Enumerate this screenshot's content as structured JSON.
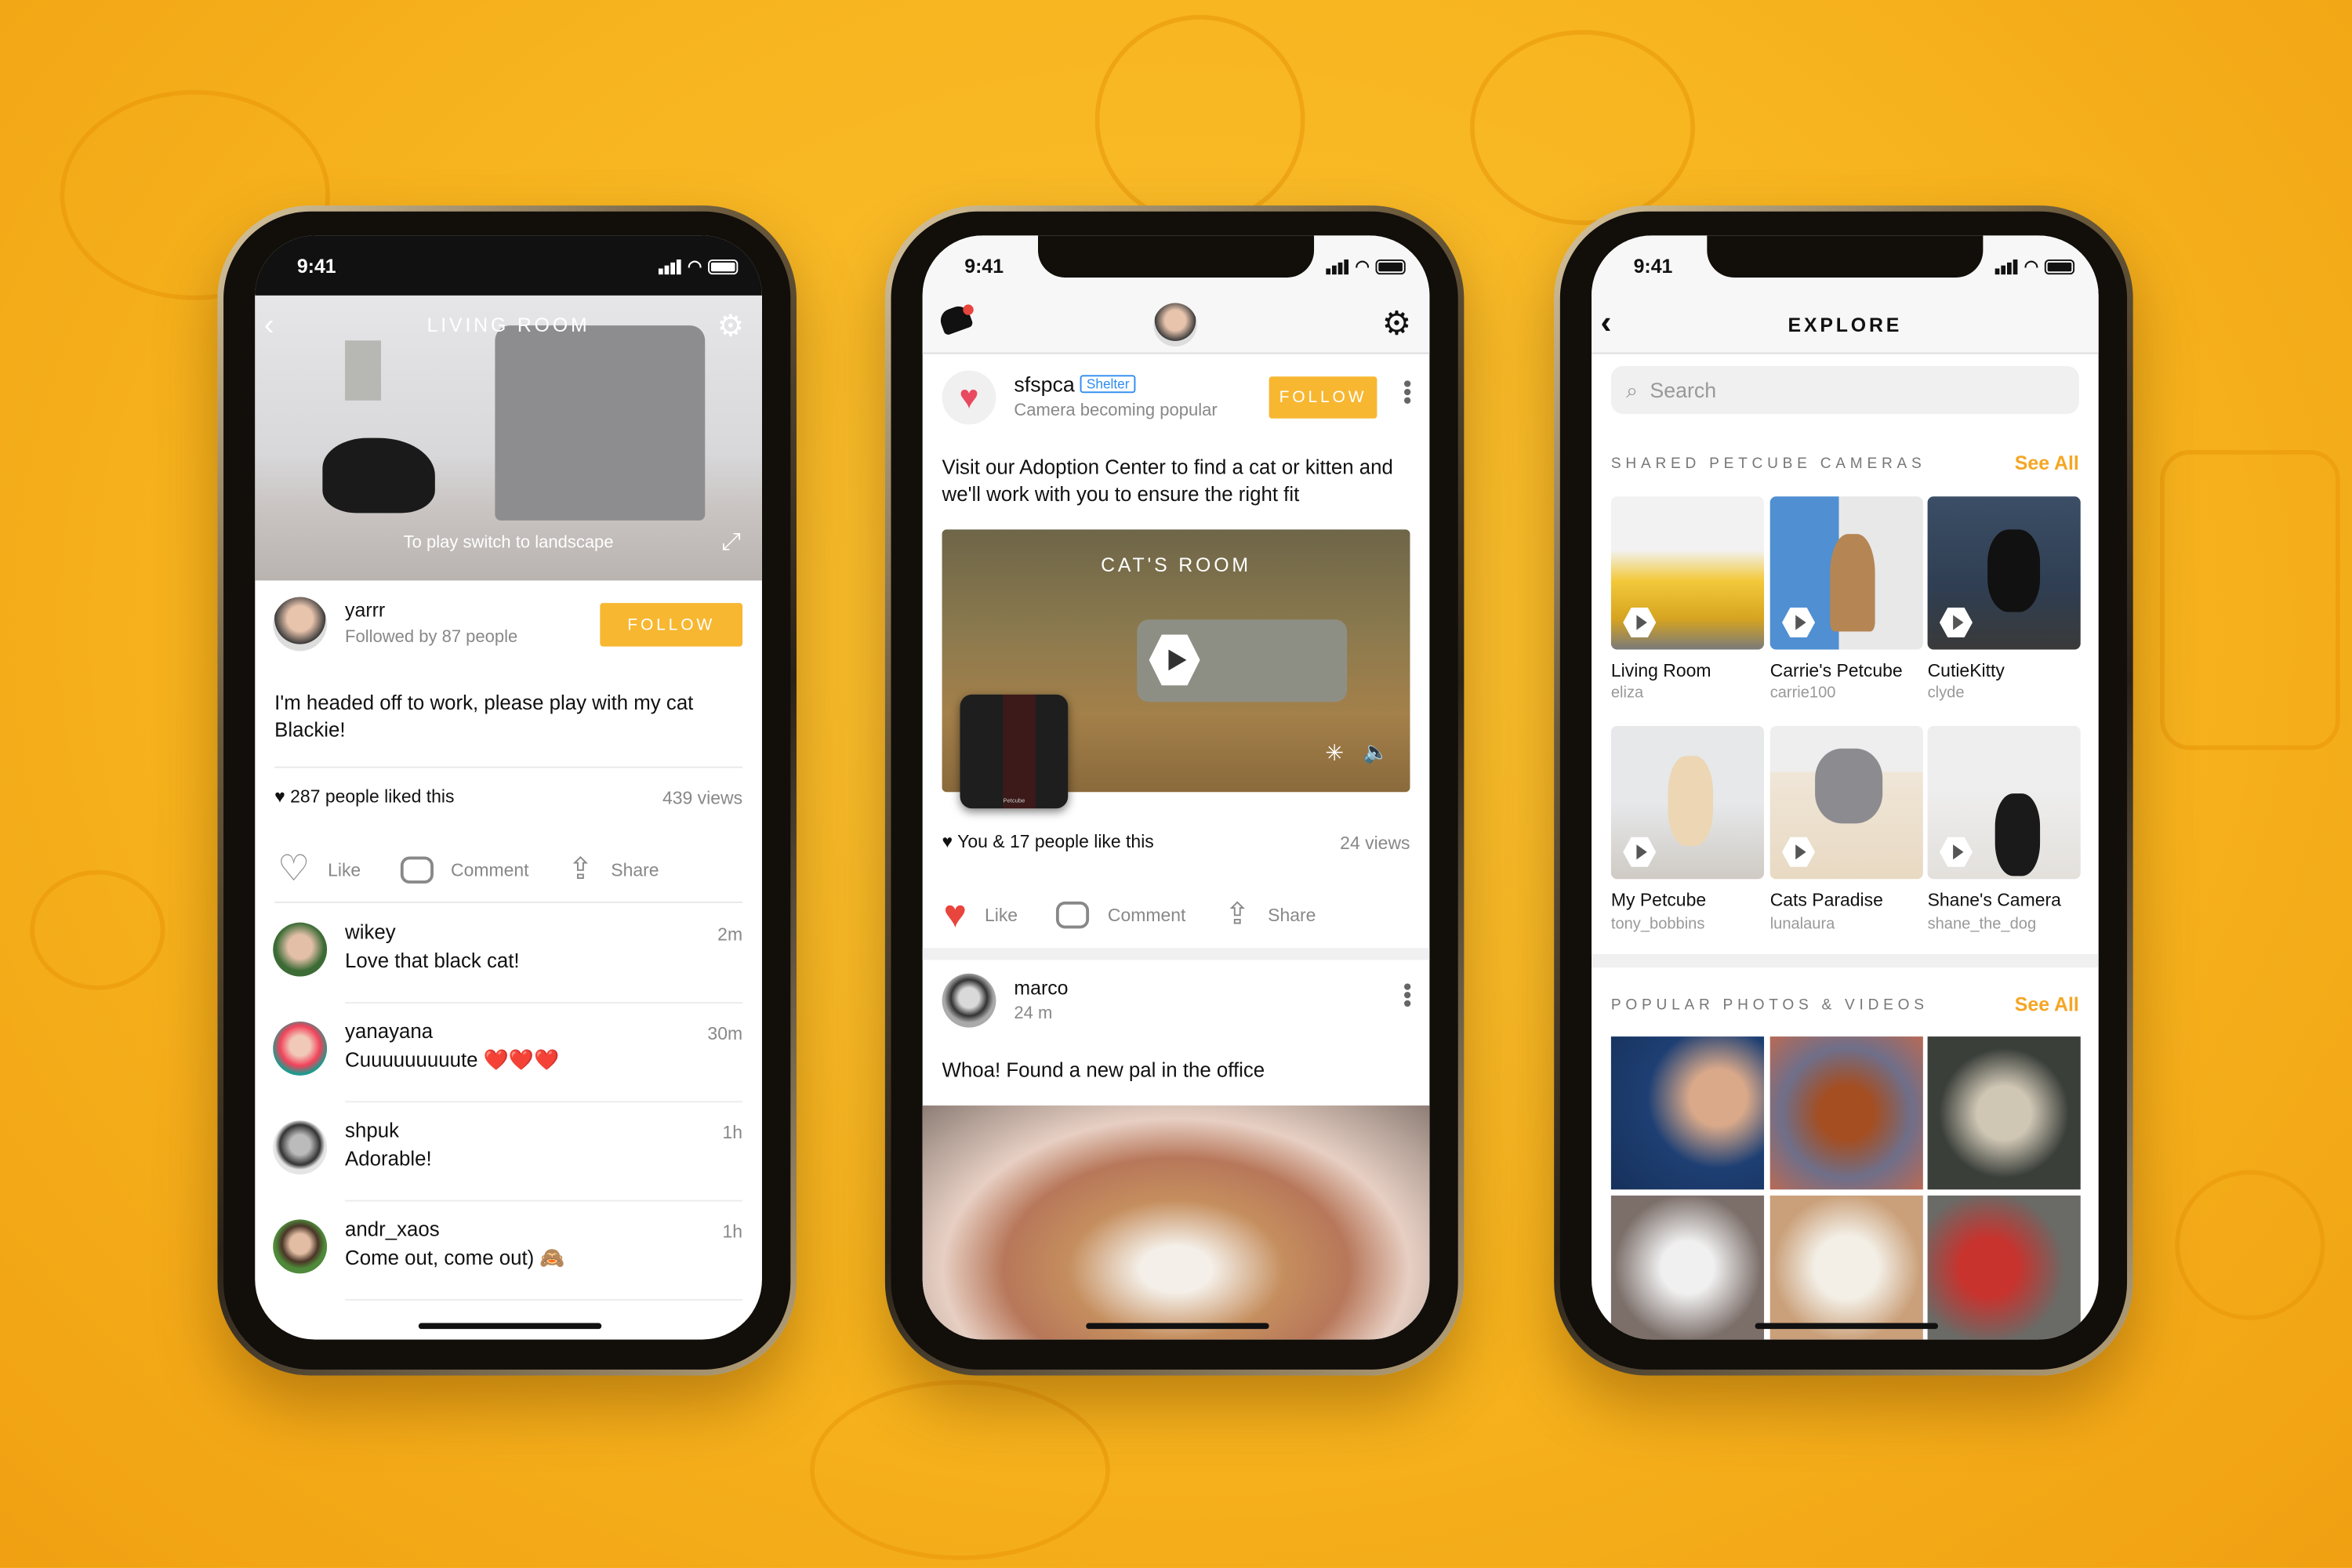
{
  "colors": {
    "accent": "#f7b731",
    "background": "#f6b21c",
    "like_red": "#e8453c",
    "shelter_blue": "#2d8cf0"
  },
  "phone1": {
    "status": {
      "time": "9:41"
    },
    "camera": {
      "title": "LIVING ROOM",
      "caption": "To play switch to landscape",
      "icons": [
        "back-icon",
        "gear-icon",
        "expand-icon"
      ]
    },
    "owner": {
      "name": "yarrr",
      "followed": "Followed by 87 people",
      "follow_label": "FOLLOW"
    },
    "post_text": "I'm headed off to work, please play with my cat Blackie!",
    "likes": "287 people liked this",
    "views": "439 views",
    "actions": {
      "like": "Like",
      "comment": "Comment",
      "share": "Share"
    },
    "comments": [
      {
        "user": "wikey",
        "text": "Love that black cat!",
        "time": "2m"
      },
      {
        "user": "yanayana",
        "text": "Cuuuuuuuuute ❤️❤️❤️",
        "time": "30m"
      },
      {
        "user": "shpuk",
        "text": "Adorable!",
        "time": "1h"
      },
      {
        "user": "andr_xaos",
        "text": "Come out, come out) 🙈",
        "time": "1h"
      }
    ]
  },
  "phone2": {
    "status": {
      "time": "9:41"
    },
    "header": {
      "icons": [
        "bell-icon",
        "avatar",
        "gear-icon"
      ]
    },
    "post1": {
      "user": "sfspca",
      "badge": "Shelter",
      "sub": "Camera becoming popular",
      "follow_label": "FOLLOW",
      "text": "Visit our Adoption Center to find a cat or kitten and we'll work with you to ensure the right fit",
      "video_title": "CAT'S ROOM",
      "device_label": "Petcube",
      "likes": "You & 17 people like this",
      "views": "24 views",
      "liked": true
    },
    "actions": {
      "like": "Like",
      "comment": "Comment",
      "share": "Share"
    },
    "post2": {
      "user": "marco",
      "time": "24 m",
      "text": "Whoa! Found a new pal in the office"
    }
  },
  "phone3": {
    "status": {
      "time": "9:41"
    },
    "title": "EXPLORE",
    "search_placeholder": "Search",
    "shared": {
      "label": "SHARED PETCUBE CAMERAS",
      "see_all": "See All",
      "cameras": [
        {
          "title": "Living Room",
          "user": "eliza"
        },
        {
          "title": "Carrie's Petcube",
          "user": "carrie100"
        },
        {
          "title": "CutieKitty",
          "user": "clyde"
        },
        {
          "title": "My Petcube",
          "user": "tony_bobbins"
        },
        {
          "title": "Cats Paradise",
          "user": "lunalaura"
        },
        {
          "title": "Shane's Camera",
          "user": "shane_the_dog"
        }
      ]
    },
    "popular": {
      "label": "POPULAR PHOTOS & VIDEOS",
      "see_all": "See All"
    }
  }
}
